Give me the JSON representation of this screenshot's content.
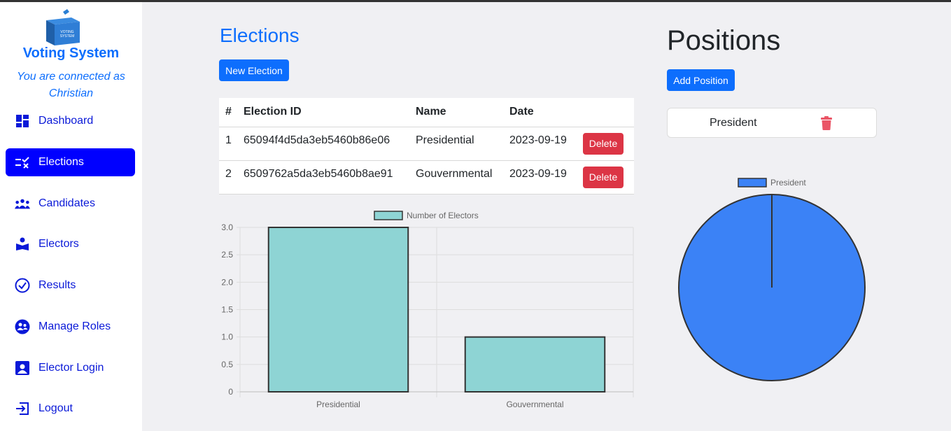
{
  "sidebar": {
    "brand": "Voting System",
    "connected_line1": "You are connected as",
    "connected_user": "Christian",
    "items": [
      {
        "label": "Dashboard",
        "icon": "dashboard-icon"
      },
      {
        "label": "Elections",
        "icon": "elections-icon",
        "active": true
      },
      {
        "label": "Candidates",
        "icon": "candidates-icon"
      },
      {
        "label": "Electors",
        "icon": "electors-icon"
      },
      {
        "label": "Results",
        "icon": "results-icon"
      },
      {
        "label": "Manage Roles",
        "icon": "manage-roles-icon"
      },
      {
        "label": "Elector Login",
        "icon": "elector-login-icon"
      },
      {
        "label": "Logout",
        "icon": "logout-icon"
      }
    ]
  },
  "elections": {
    "title": "Elections",
    "new_button": "New Election",
    "table": {
      "headers": [
        "#",
        "Election ID",
        "Name",
        "Date"
      ],
      "rows": [
        {
          "num": "1",
          "id": "65094f4d5da3eb5460b86e06",
          "name": "Presidential",
          "date": "2023-09-19",
          "action": "Delete"
        },
        {
          "num": "2",
          "id": "6509762a5da3eb5460b8ae91",
          "name": "Gouvernmental",
          "date": "2023-09-19",
          "action": "Delete"
        }
      ]
    }
  },
  "positions": {
    "title": "Positions",
    "add_button": "Add Position",
    "items": [
      {
        "name": "President"
      }
    ]
  },
  "colors": {
    "primary": "#0d6efd",
    "active_nav": "#0000ff",
    "danger": "#dc3545",
    "bar_fill": "#8ed4d4",
    "pie_fill": "#3b82f6"
  },
  "chart_data": [
    {
      "type": "bar",
      "categories": [
        "Presidential",
        "Gouvernmental"
      ],
      "series": [
        {
          "name": "Number of Electors",
          "values": [
            3,
            1
          ]
        }
      ],
      "ylim": [
        0,
        3
      ],
      "yticks": [
        "0",
        "0.5",
        "1.0",
        "1.5",
        "2.0",
        "2.5",
        "3.0"
      ],
      "grid": true,
      "legend": "top"
    },
    {
      "type": "pie",
      "labels": [
        "President"
      ],
      "values": [
        1
      ],
      "legend": "top"
    }
  ]
}
